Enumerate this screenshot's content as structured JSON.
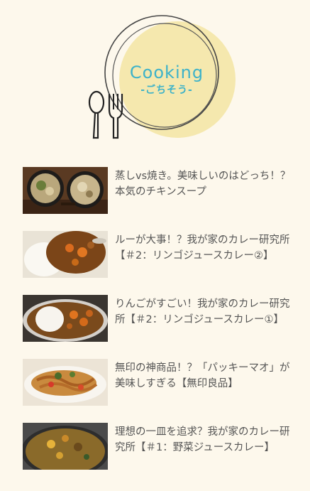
{
  "logo": {
    "title": "Cooking",
    "subtitle": "-ごちそう-",
    "colors": {
      "text": "#3db2c9",
      "circle_fill": "#f5e8ae",
      "stroke": "#333333"
    }
  },
  "articles": [
    {
      "title": "蒸しvs焼き。美味しいのはどっち！？本気のチキンスープ",
      "thumb": "chicken-soup-photo"
    },
    {
      "title": "ルーが大事！？我が家のカレー研究所【＃2：リンゴジュースカレー②】",
      "thumb": "curry-photo"
    },
    {
      "title": "りんごがすごい！我が家のカレー研究所【＃2：リンゴジュースカレー①】",
      "thumb": "curry-rice-photo"
    },
    {
      "title": "無印の神商品！？「パッキーマオ」が美味しすぎる【無印良品】",
      "thumb": "noodle-dish-photo"
    },
    {
      "title": "理想の一皿を追求？我が家のカレー研究所【＃1：野菜ジュースカレー】",
      "thumb": "vegetable-curry-photo"
    }
  ]
}
